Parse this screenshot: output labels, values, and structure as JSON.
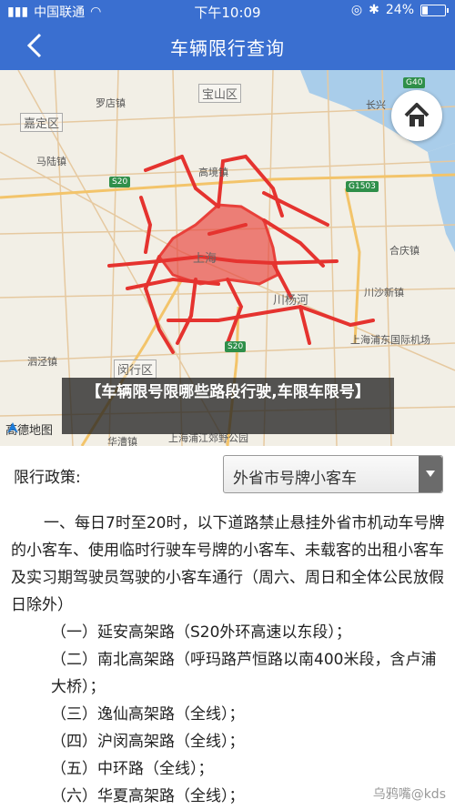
{
  "status_bar": {
    "carrier": "中国联通",
    "time": "下午10:09",
    "battery": "24%"
  },
  "nav": {
    "title": "车辆限行查询"
  },
  "map": {
    "labels": {
      "baoshan": "宝山区",
      "luodian": "罗店镇",
      "jiading": "嘉定区",
      "malu": "马陆镇",
      "gaojing": "高境镇",
      "shanghai": "上海",
      "chuanyang": "川杨河",
      "chuansha": "川沙新镇",
      "hechang": "合庆镇",
      "changxing": "长兴",
      "sijing": "泗泾镇",
      "minhang": "闵行区",
      "pudong_airport": "上海浦东国际机场",
      "pujiang": "上海浦江郊野公园",
      "zhuanqiao": "华漕镇"
    },
    "shields": [
      "G40",
      "S20",
      "G1503",
      "S20"
    ],
    "logo": "高德地图"
  },
  "article_title": "【车辆限号限哪些路段行驶,车限车限号】",
  "policy": {
    "label": "限行政策:",
    "selected": "外省市号牌小客车"
  },
  "content": {
    "intro": "一、每日7时至20时，以下道路禁止悬挂外省市机动车号牌的小客车、使用临时行驶车号牌的小客车、未载客的出租小客车及实习期驾驶员驾驶的小客车通行（周六、周日和全体公民放假日除外）",
    "items": [
      "（一）延安高架路（S20外环高速以东段）；",
      "（二）南北高架路（呼玛路芦恒路以南400米段，含卢浦大桥）；",
      "（三）逸仙高架路（全线）；",
      "（四）沪闵高架路（全线）；",
      "（五）中环路（全线）；",
      "（六）华夏高架路（全线）；"
    ]
  },
  "watermark": "乌鸦嘴@kds",
  "colors": {
    "header": "#3a6fd0",
    "restricted_zone": "#e8403a"
  }
}
